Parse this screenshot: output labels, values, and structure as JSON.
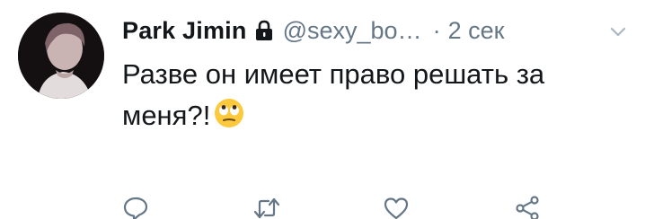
{
  "tweet": {
    "display_name": "Park Jimin",
    "handle": "@sexy_bo…",
    "separator": "·",
    "time": "2 сек",
    "text": "Разве он имеет право решать за меня?!",
    "emoji": "face-with-rolling-eyes"
  },
  "icons": {
    "protected": "lock-icon",
    "menu": "chevron-down-icon",
    "reply": "reply-icon",
    "retweet": "retweet-icon",
    "like": "heart-icon",
    "share": "share-icon"
  },
  "colors": {
    "text": "#14171a",
    "secondary": "#657786",
    "action_icon": "#657786"
  }
}
